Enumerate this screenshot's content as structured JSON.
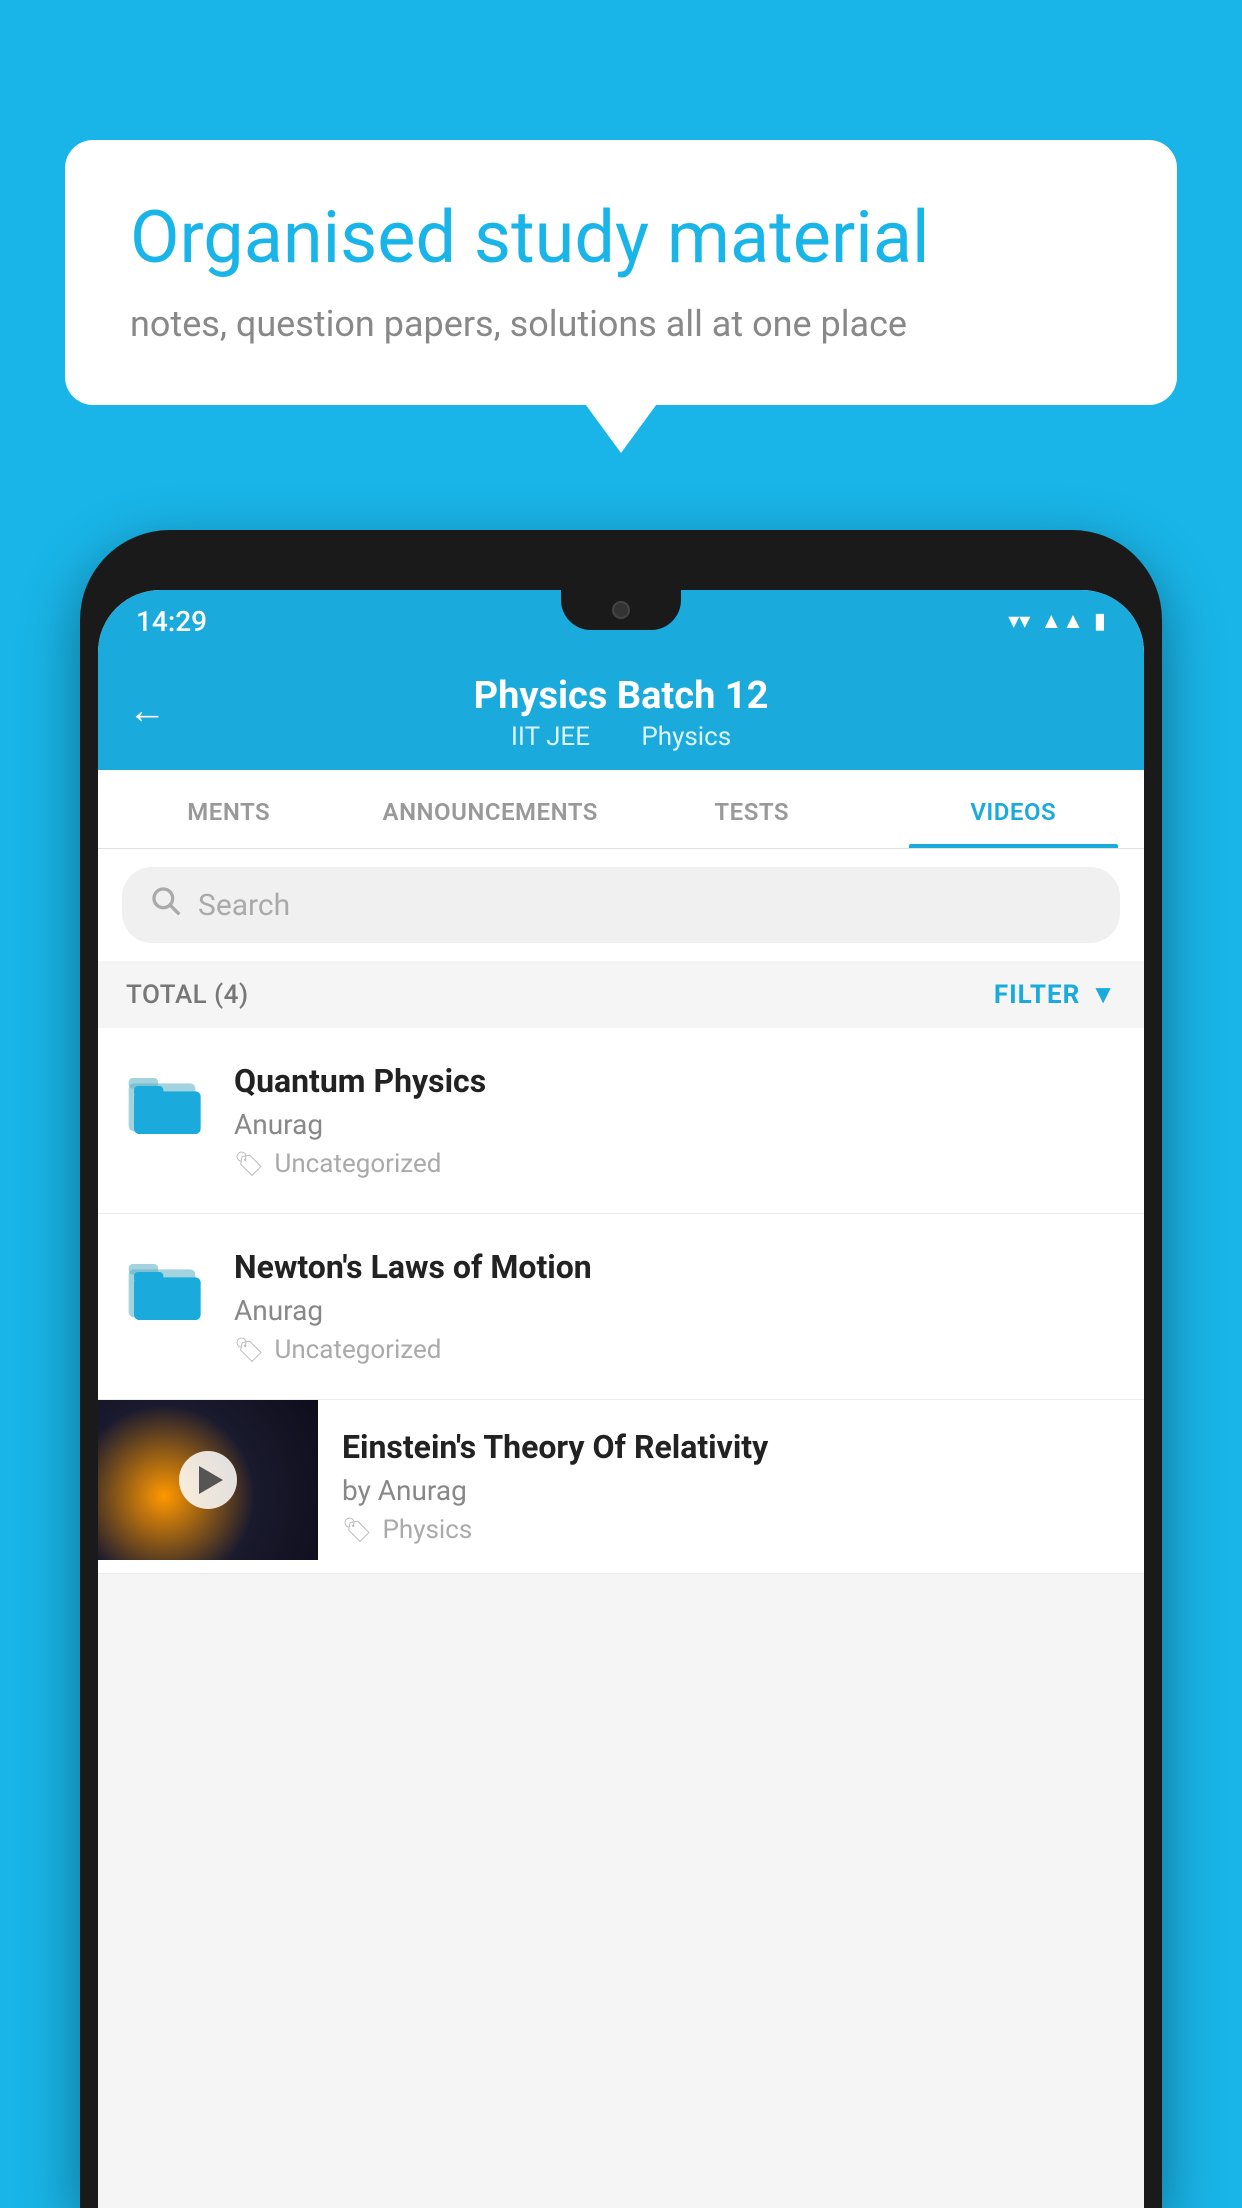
{
  "background_color": "#19b5e8",
  "bubble": {
    "title": "Organised study material",
    "subtitle": "notes, question papers, solutions all at one place"
  },
  "status_bar": {
    "time": "14:29",
    "icons": [
      "▼",
      "▲",
      "▌"
    ]
  },
  "header": {
    "title": "Physics Batch 12",
    "subtitle_part1": "IIT JEE",
    "subtitle_part2": "Physics",
    "back_label": "←"
  },
  "tabs": [
    {
      "label": "MENTS",
      "active": false
    },
    {
      "label": "ANNOUNCEMENTS",
      "active": false
    },
    {
      "label": "TESTS",
      "active": false
    },
    {
      "label": "VIDEOS",
      "active": true
    }
  ],
  "search": {
    "placeholder": "Search"
  },
  "filter": {
    "total_label": "TOTAL (4)",
    "filter_label": "FILTER"
  },
  "list_items": [
    {
      "title": "Quantum Physics",
      "author": "Anurag",
      "tag": "Uncategorized",
      "type": "folder"
    },
    {
      "title": "Newton's Laws of Motion",
      "author": "Anurag",
      "tag": "Uncategorized",
      "type": "folder"
    }
  ],
  "video_item": {
    "title": "Einstein's Theory Of Relativity",
    "author": "by Anurag",
    "tag": "Physics",
    "type": "video"
  }
}
